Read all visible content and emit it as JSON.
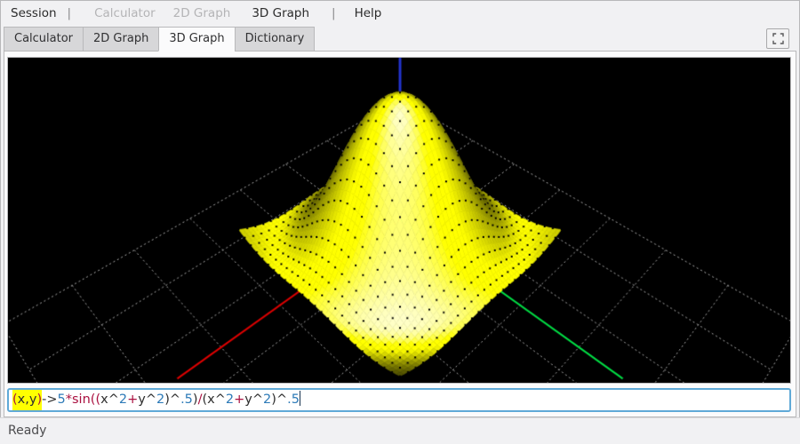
{
  "menubar": {
    "items": [
      {
        "label": "Session",
        "type": "item",
        "enabled": true
      },
      {
        "label": "|",
        "type": "separator"
      },
      {
        "label": "Calculator",
        "type": "item",
        "enabled": false
      },
      {
        "label": "2D Graph",
        "type": "item",
        "enabled": false
      },
      {
        "label": "3D Graph",
        "type": "item",
        "enabled": true
      },
      {
        "label": "|",
        "type": "separator"
      },
      {
        "label": "Help",
        "type": "item",
        "enabled": true
      }
    ]
  },
  "tabbar": {
    "active": "3D Graph",
    "tabs": [
      {
        "label": "Calculator"
      },
      {
        "label": "2D Graph"
      },
      {
        "label": "3D Graph"
      },
      {
        "label": "Dictionary"
      }
    ]
  },
  "plot3d": {
    "background": "#000000",
    "surface": {
      "expression": "5*sin((x^2+y^2)^.5)/(x^2+y^2)^.5",
      "domain": [
        -4,
        4
      ],
      "peak_height": 5,
      "mesh_divisions": 50,
      "dot_every": 2,
      "dot_color": "#000000"
    },
    "grid": {
      "color": "#ababab",
      "extent": 12,
      "step": 3,
      "plane_z": -6.5
    },
    "axes": {
      "x_color": "#dd0000",
      "y_color": "#00dd44",
      "z_color": "#2233cc",
      "xy_length": 8.5,
      "z_length": 8
    },
    "camera": {
      "center": [
        442,
        183
      ],
      "sin_elev": 0.718,
      "cos_elev": 0.696,
      "distance": 19.4,
      "focal": 636
    }
  },
  "input": {
    "value": "(x,y)->5*sin((x^2+y^2)^.5)/(x^2+y^2)^.5",
    "tokens": [
      {
        "t": "(",
        "c": "op",
        "hl": true
      },
      {
        "t": "x,y",
        "c": "plain",
        "hl": true
      },
      {
        "t": ")",
        "c": "op",
        "hl": true
      },
      {
        "t": "->",
        "c": "plain"
      },
      {
        "t": "5",
        "c": "num"
      },
      {
        "t": "*",
        "c": "op"
      },
      {
        "t": "sin",
        "c": "func"
      },
      {
        "t": "((",
        "c": "func"
      },
      {
        "t": "x",
        "c": "plain"
      },
      {
        "t": "^",
        "c": "plain"
      },
      {
        "t": "2",
        "c": "num"
      },
      {
        "t": "+",
        "c": "op"
      },
      {
        "t": "y",
        "c": "plain"
      },
      {
        "t": "^",
        "c": "plain"
      },
      {
        "t": "2",
        "c": "num"
      },
      {
        "t": ")",
        "c": "plain"
      },
      {
        "t": "^",
        "c": "plain"
      },
      {
        "t": ".5",
        "c": "num"
      },
      {
        "t": ")",
        "c": "plain"
      },
      {
        "t": "/",
        "c": "op"
      },
      {
        "t": "(",
        "c": "plain"
      },
      {
        "t": "x",
        "c": "plain"
      },
      {
        "t": "^",
        "c": "plain"
      },
      {
        "t": "2",
        "c": "num"
      },
      {
        "t": "+",
        "c": "op"
      },
      {
        "t": "y",
        "c": "plain"
      },
      {
        "t": "^",
        "c": "plain"
      },
      {
        "t": "2",
        "c": "num"
      },
      {
        "t": ")",
        "c": "plain"
      },
      {
        "t": "^",
        "c": "plain"
      },
      {
        "t": ".5",
        "c": "num"
      }
    ],
    "colors": {
      "num": "#2e7bb8",
      "op": "#aa1040",
      "func": "#aa1040",
      "plain": "#2e2e2e",
      "highlight_bg": "#ffff00",
      "caret": "#16324f"
    }
  },
  "statusbar": {
    "text": "Ready"
  }
}
